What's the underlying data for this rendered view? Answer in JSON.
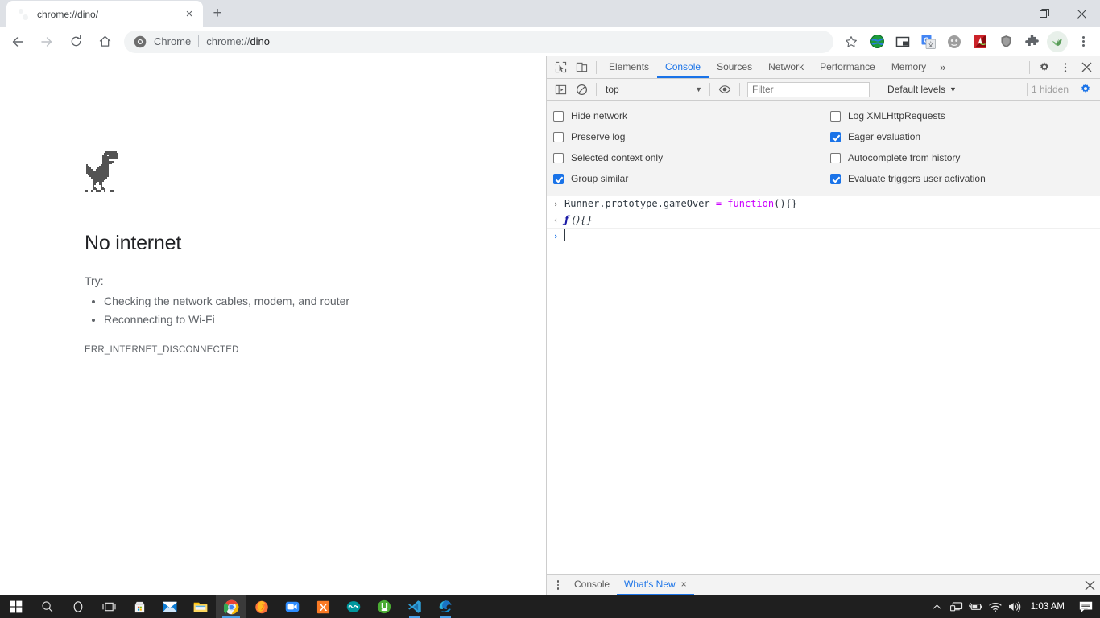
{
  "browser": {
    "tab": {
      "title": "chrome://dino/",
      "favicon": "globe-icon",
      "close_label": "×"
    },
    "new_tab_label": "+",
    "window_controls": {
      "minimize": "minimize-icon",
      "restore": "restore-icon",
      "close": "close-icon"
    },
    "nav": {
      "back": "back-arrow-icon",
      "forward": "forward-arrow-icon",
      "reload": "reload-icon",
      "home": "home-icon"
    },
    "omnibox": {
      "chip_label": "Chrome",
      "url_scheme": "chrome://",
      "url_host": "dino",
      "full_url": "chrome://dino",
      "star": "bookmark-star-icon"
    },
    "extensions": [
      {
        "name": "idm-extension-icon",
        "color": "#2e8b57"
      },
      {
        "name": "picture-in-picture-icon",
        "color": "#3c4043"
      },
      {
        "name": "google-translate-icon",
        "color": "#4285f4"
      },
      {
        "name": "grammar-extension-icon",
        "color": "#9e9e9e"
      },
      {
        "name": "adobe-acrobat-icon",
        "color": "#cc2229"
      },
      {
        "name": "shield-extension-icon",
        "color": "#757575"
      },
      {
        "name": "puzzle-extensions-icon",
        "color": "#5f6368"
      }
    ],
    "profile_avatar": "profile-avatar-icon",
    "menu": "chrome-menu-icon"
  },
  "error_page": {
    "dino": "dinosaur-sprite",
    "heading": "No internet",
    "try_label": "Try:",
    "suggestions": [
      "Checking the network cables, modem, and router",
      "Reconnecting to Wi-Fi"
    ],
    "error_code": "ERR_INTERNET_DISCONNECTED"
  },
  "devtools": {
    "left_buttons": [
      {
        "name": "inspect-element-icon"
      },
      {
        "name": "device-toolbar-icon"
      }
    ],
    "tabs": [
      {
        "label": "Elements",
        "active": false
      },
      {
        "label": "Console",
        "active": true
      },
      {
        "label": "Sources",
        "active": false
      },
      {
        "label": "Network",
        "active": false
      },
      {
        "label": "Performance",
        "active": false
      },
      {
        "label": "Memory",
        "active": false
      }
    ],
    "more_tabs_label": "»",
    "right_buttons": [
      {
        "name": "settings-gear-icon"
      },
      {
        "name": "customize-menu-icon"
      },
      {
        "name": "close-devtools-icon"
      }
    ],
    "console_toolbar": {
      "sidebar_toggle": "console-sidebar-icon",
      "clear_label": "clear-console-icon",
      "context": "top",
      "context_caret": "▼",
      "live_expression": "eye-icon",
      "filter_placeholder": "Filter",
      "filter_value": "",
      "levels": "Default levels",
      "levels_caret": "▼",
      "hidden_count": "1 hidden",
      "settings_gear": "console-settings-gear-icon"
    },
    "settings": {
      "left": [
        {
          "label": "Hide network",
          "checked": false
        },
        {
          "label": "Preserve log",
          "checked": false
        },
        {
          "label": "Selected context only",
          "checked": false
        },
        {
          "label": "Group similar",
          "checked": true
        }
      ],
      "right": [
        {
          "label": "Log XMLHttpRequests",
          "checked": false
        },
        {
          "label": "Eager evaluation",
          "checked": true
        },
        {
          "label": "Autocomplete from history",
          "checked": false
        },
        {
          "label": "Evaluate triggers user activation",
          "checked": true
        }
      ]
    },
    "log": {
      "input_gutter": "›",
      "input_code_plain1": "Runner.prototype.gameOver ",
      "input_code_op": "=",
      "input_code_kw": " function",
      "input_code_plain2": "(){}",
      "input_full": "Runner.prototype.gameOver = function(){}",
      "output_gutter": "‹",
      "output_fsym": "ƒ",
      "output_text": " (){}",
      "prompt_gutter": "›"
    },
    "drawer": {
      "menu": "drawer-menu-icon",
      "tabs": [
        {
          "label": "Console",
          "active": false,
          "closable": false
        },
        {
          "label": "What's New",
          "active": true,
          "closable": true,
          "close": "×"
        }
      ],
      "close": "close-drawer-icon"
    }
  },
  "taskbar": {
    "start": "windows-start-icon",
    "items": [
      {
        "name": "search-icon",
        "state": "idle"
      },
      {
        "name": "cortana-icon",
        "state": "idle"
      },
      {
        "name": "task-view-icon",
        "state": "idle"
      },
      {
        "name": "microsoft-store-icon",
        "state": "idle"
      },
      {
        "name": "mail-icon",
        "state": "idle"
      },
      {
        "name": "file-explorer-icon",
        "state": "idle"
      },
      {
        "name": "google-chrome-icon",
        "state": "active"
      },
      {
        "name": "firefox-icon",
        "state": "idle"
      },
      {
        "name": "zoom-icon",
        "state": "idle"
      },
      {
        "name": "xampp-icon",
        "state": "idle"
      },
      {
        "name": "arduino-icon",
        "state": "idle"
      },
      {
        "name": "utorrent-icon",
        "state": "idle"
      },
      {
        "name": "vs-code-icon",
        "state": "running"
      },
      {
        "name": "microsoft-edge-icon",
        "state": "running"
      }
    ],
    "tray": [
      {
        "name": "show-hidden-icons-chevron"
      },
      {
        "name": "network-monitor-icon"
      },
      {
        "name": "battery-icon"
      },
      {
        "name": "wifi-icon"
      },
      {
        "name": "volume-icon"
      }
    ],
    "clock": "1:03 AM",
    "action_center": "action-center-icon"
  }
}
